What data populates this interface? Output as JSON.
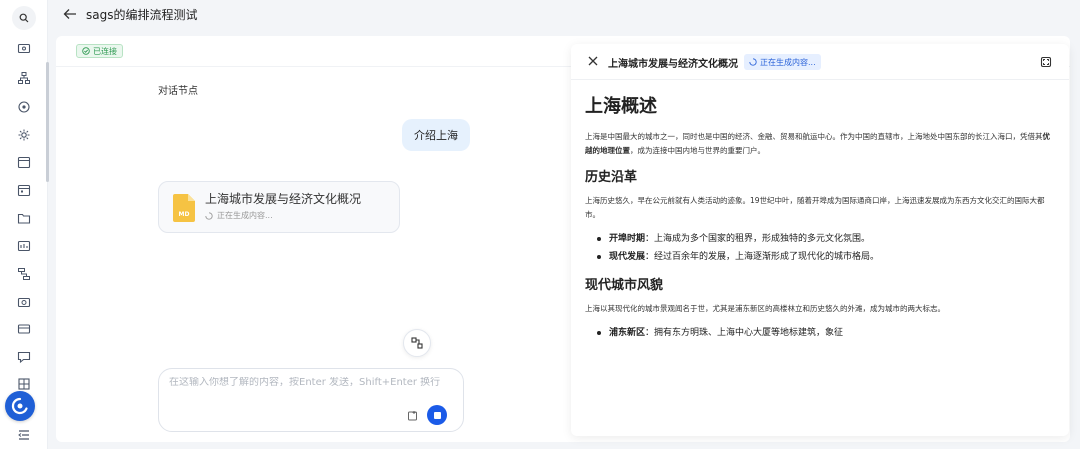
{
  "topbar": {
    "title": "sags的编排流程测试"
  },
  "status": {
    "connected": "已连接"
  },
  "chat": {
    "node_label": "对话节点",
    "user_message": "介绍上海",
    "file_card": {
      "title": "上海城市发展与经济文化概况",
      "status": "正在生成内容...",
      "file_type": "MD"
    },
    "input": {
      "placeholder": "在这输入你想了解的内容，按Enter 发送，Shift+Enter 换行",
      "value": ""
    }
  },
  "doc": {
    "title": "上海城市发展与经济文化概况",
    "status": "正在生成内容...",
    "h1": "上海概述",
    "intro_before": "上海是中国最大的城市之一，同时也是中国的经济、金融、贸易和航运中心。作为中国的直辖市，上海地处中国东部的长江入海口，凭借其",
    "intro_bold": "优越的地理位置",
    "intro_after": "，成为连接中国内地与世界的重要门户。",
    "s1_title": "历史沿革",
    "s1_text": "上海历史悠久，早在公元前就有人类活动的迹象。19世纪中叶，随着开埠成为国际通商口岸，上海迅速发展成为东西方文化交汇的国际大都市。",
    "s1_items": [
      {
        "label": "开埠时期",
        "text": "：上海成为多个国家的租界，形成独特的多元文化氛围。"
      },
      {
        "label": "现代发展",
        "text": "：经过百余年的发展，上海逐渐形成了现代化的城市格局。"
      }
    ],
    "s2_title": "现代城市风貌",
    "s2_text": "上海以其现代化的城市景观闻名于世，尤其是浦东新区的高楼林立和历史悠久的外滩，成为城市的两大标志。",
    "s2_items": [
      {
        "label": "浦东新区",
        "text": "：拥有东方明珠、上海中心大厦等地标建筑，象征"
      }
    ]
  },
  "colors": {
    "accent": "#1b5be8",
    "success": "#2f9a52",
    "bubble": "#e6f1fd"
  },
  "icons": [
    "search-icon",
    "back-arrow-icon",
    "close-icon",
    "expand-icon",
    "stop-icon",
    "attach-icon",
    "loading-icon"
  ]
}
